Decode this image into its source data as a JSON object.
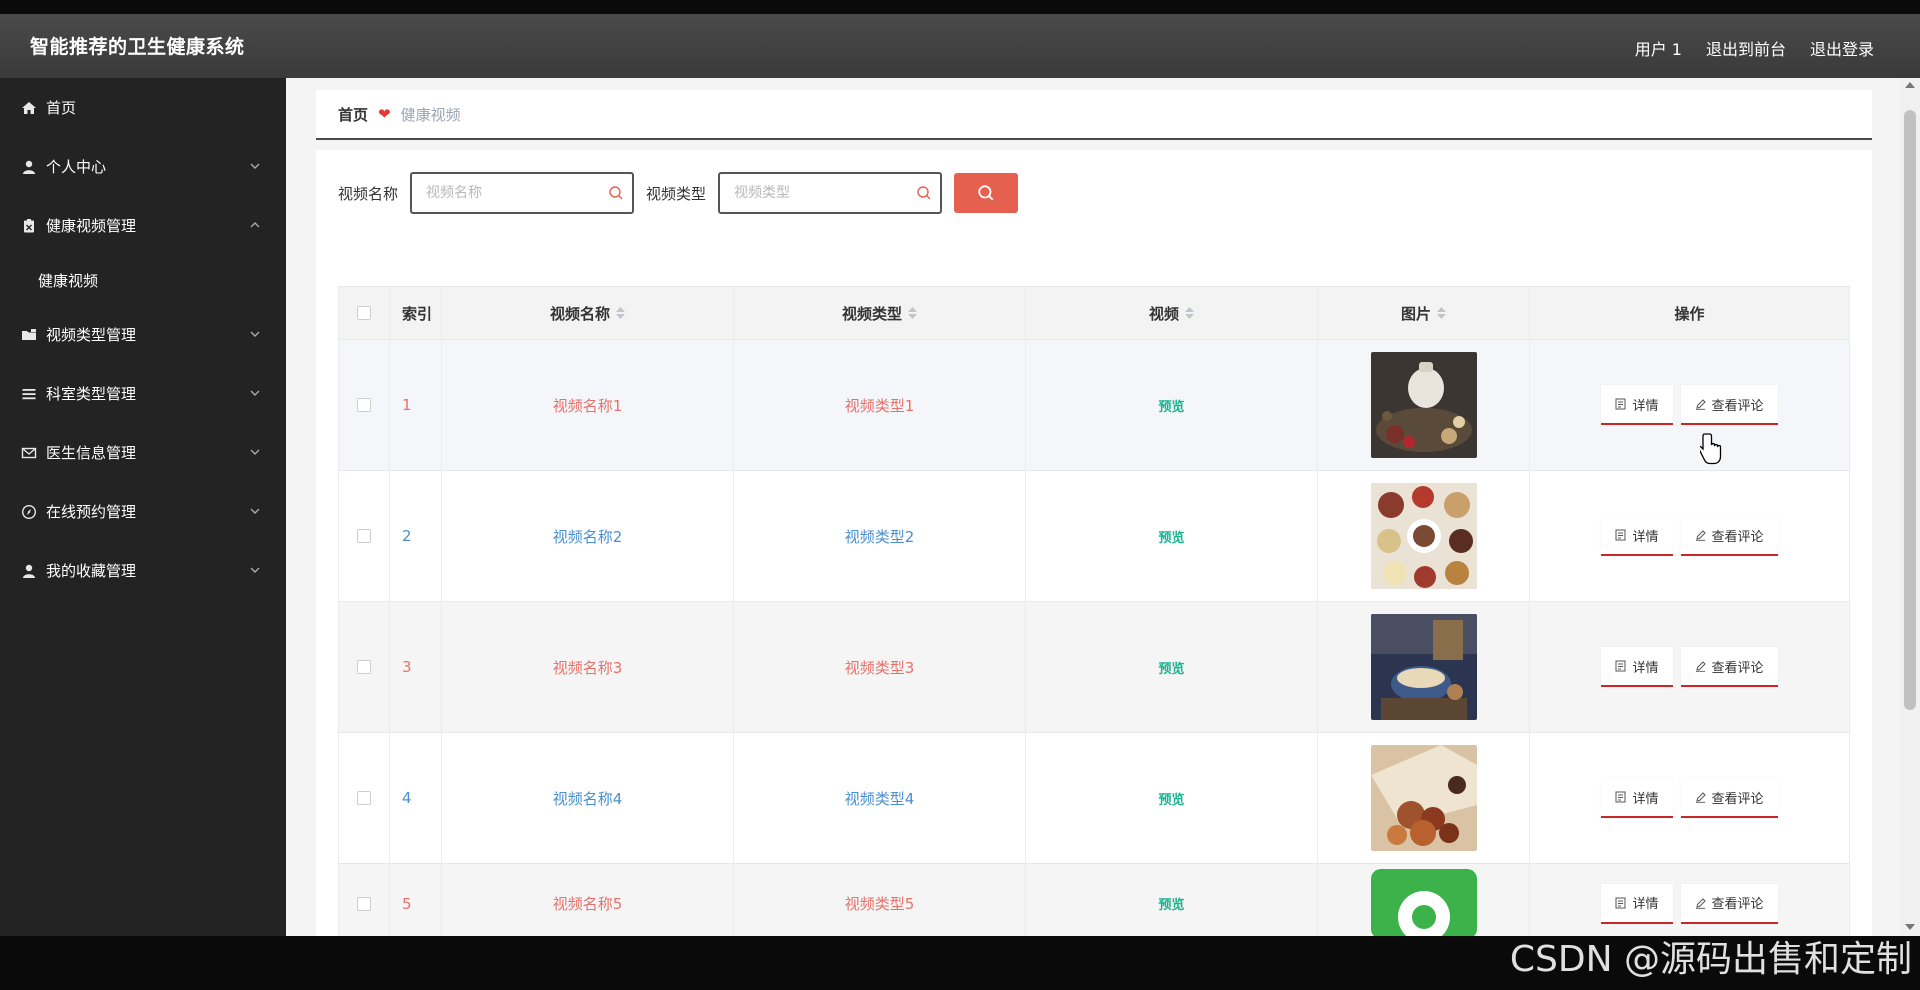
{
  "header": {
    "brand": "智能推荐的卫生健康系统",
    "user": "用户 1",
    "front_link": "退出到前台",
    "logout": "退出登录"
  },
  "sidebar": {
    "items": [
      {
        "label": "首页",
        "icon": "home-icon",
        "expandable": false
      },
      {
        "label": "个人中心",
        "icon": "user-icon",
        "expandable": true,
        "expanded": false
      },
      {
        "label": "健康视频管理",
        "icon": "clipboard-icon",
        "expandable": true,
        "expanded": true,
        "children": [
          "健康视频"
        ]
      },
      {
        "label": "视频类型管理",
        "icon": "folder-icon",
        "expandable": true,
        "expanded": false
      },
      {
        "label": "科室类型管理",
        "icon": "list-icon",
        "expandable": true,
        "expanded": false
      },
      {
        "label": "医生信息管理",
        "icon": "mail-icon",
        "expandable": true,
        "expanded": false
      },
      {
        "label": "在线预约管理",
        "icon": "compass-icon",
        "expandable": true,
        "expanded": false
      },
      {
        "label": "我的收藏管理",
        "icon": "person-icon",
        "expandable": true,
        "expanded": false
      }
    ]
  },
  "breadcrumb": {
    "home": "首页",
    "current": "健康视频"
  },
  "search": {
    "name_label": "视频名称",
    "name_placeholder": "视频名称",
    "type_label": "视频类型",
    "type_placeholder": "视频类型"
  },
  "table": {
    "headers": {
      "index": "索引",
      "name": "视频名称",
      "type": "视频类型",
      "video": "视频",
      "image": "图片",
      "ops": "操作"
    },
    "rows": [
      {
        "index": "1",
        "name": "视频名称1",
        "type": "视频类型1",
        "video": "预览",
        "color": "red"
      },
      {
        "index": "2",
        "name": "视频名称2",
        "type": "视频类型2",
        "video": "预览",
        "color": "blue"
      },
      {
        "index": "3",
        "name": "视频名称3",
        "type": "视频类型3",
        "video": "预览",
        "color": "red"
      },
      {
        "index": "4",
        "name": "视频名称4",
        "type": "视频类型4",
        "video": "预览",
        "color": "blue"
      },
      {
        "index": "5",
        "name": "视频名称5",
        "type": "视频类型5",
        "video": "预览",
        "color": "red"
      }
    ],
    "detail_label": "详情",
    "comment_label": "查看评论"
  },
  "colors": {
    "accent": "#e5604f",
    "link_red": "#e8716a",
    "link_blue": "#4a8fd2",
    "preview_green": "#19b390",
    "sidebar_bg": "#232323"
  },
  "watermark": "CSDN @源码出售和定制"
}
